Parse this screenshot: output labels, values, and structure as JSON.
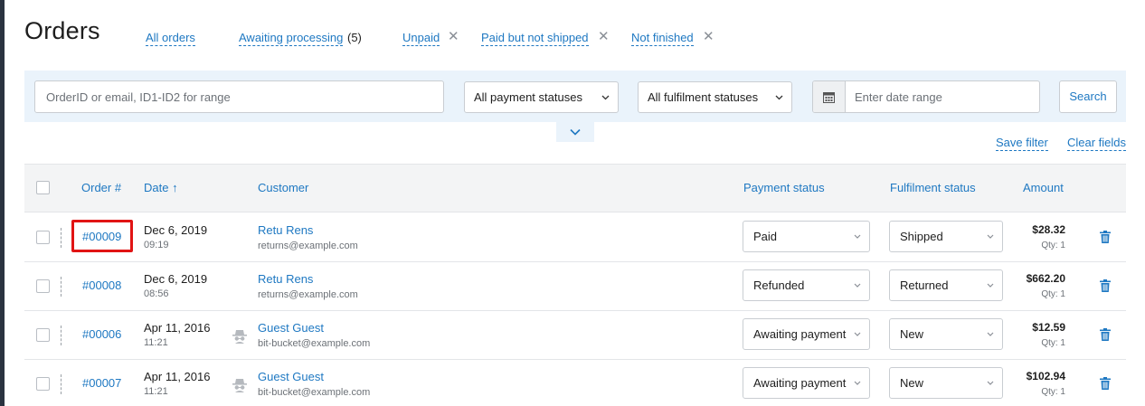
{
  "page": {
    "title": "Orders"
  },
  "tabs": [
    {
      "label": "All orders",
      "closable": false
    },
    {
      "label": "Awaiting processing",
      "count": "(5)",
      "closable": false
    },
    {
      "label": "Unpaid",
      "closable": true
    },
    {
      "label": "Paid but not shipped",
      "closable": true
    },
    {
      "label": "Not finished",
      "closable": true
    }
  ],
  "filters": {
    "search_placeholder": "OrderID or email, ID1-ID2 for range",
    "payment_status": "All payment statuses",
    "fulfilment_status": "All fulfilment statuses",
    "date_placeholder": "Enter date range",
    "search_label": "Search"
  },
  "actions": {
    "save_filter": "Save filter",
    "clear_fields": "Clear fields"
  },
  "table": {
    "headers": {
      "order": "Order #",
      "date": "Date",
      "sort_arrow": "↑",
      "customer": "Customer",
      "payment": "Payment status",
      "fulfilment": "Fulfilment status",
      "amount": "Amount"
    },
    "rows": [
      {
        "order": "#00009",
        "date": "Dec 6, 2019",
        "time": "09:19",
        "name": "Retu Rens",
        "email": "returns@example.com",
        "guest": false,
        "payment": "Paid",
        "fulfilment": "Shipped",
        "amount": "$28.32",
        "qty": "Qty: 1"
      },
      {
        "order": "#00008",
        "date": "Dec 6, 2019",
        "time": "08:56",
        "name": "Retu Rens",
        "email": "returns@example.com",
        "guest": false,
        "payment": "Refunded",
        "fulfilment": "Returned",
        "amount": "$662.20",
        "qty": "Qty: 1"
      },
      {
        "order": "#00006",
        "date": "Apr 11, 2016",
        "time": "11:21",
        "name": "Guest Guest",
        "email": "bit-bucket@example.com",
        "guest": true,
        "payment": "Awaiting payment",
        "fulfilment": "New",
        "amount": "$12.59",
        "qty": "Qty: 1"
      },
      {
        "order": "#00007",
        "date": "Apr 11, 2016",
        "time": "11:21",
        "name": "Guest Guest",
        "email": "bit-bucket@example.com",
        "guest": true,
        "payment": "Awaiting payment",
        "fulfilment": "New",
        "amount": "$102.94",
        "qty": "Qty: 1"
      }
    ]
  },
  "icons": {
    "tab_close": "close-icon",
    "select_chevron": "chevron-down-icon",
    "calendar": "calendar-icon",
    "expand": "chevron-down-icon",
    "guest": "incognito-icon",
    "delete": "trash-icon"
  },
  "colors": {
    "link": "#1e78c2",
    "filter_panel": "#eaf3fb",
    "highlight": "#e11414"
  },
  "highlighted_order": "#00009"
}
